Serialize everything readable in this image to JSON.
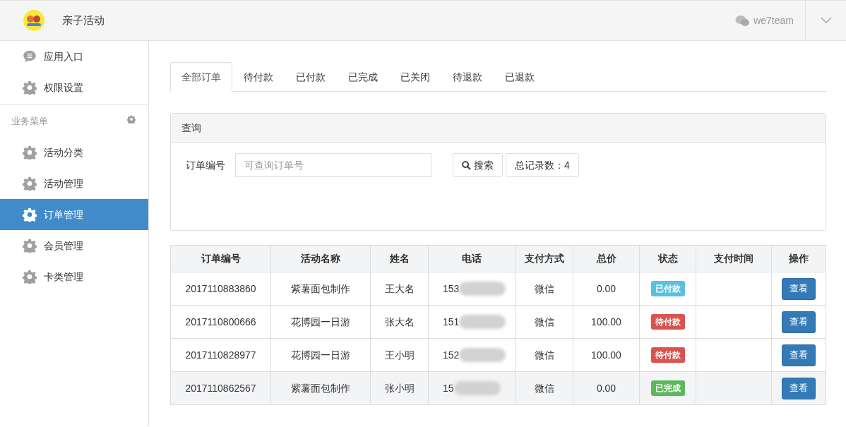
{
  "header": {
    "title": "亲子活动",
    "account": "we7team"
  },
  "sidebar": {
    "top_items": [
      {
        "label": "应用入口",
        "kind": "message",
        "selected": false
      },
      {
        "label": "权限设置",
        "kind": "settings",
        "selected": false
      }
    ],
    "section": {
      "title": "业务菜单",
      "items": [
        {
          "label": "活动分类",
          "kind": "settings",
          "selected": false
        },
        {
          "label": "活动管理",
          "kind": "settings",
          "selected": false
        },
        {
          "label": "订单管理",
          "kind": "settings",
          "selected": true
        },
        {
          "label": "会员管理",
          "kind": "settings",
          "selected": false
        },
        {
          "label": "卡类管理",
          "kind": "settings",
          "selected": false
        }
      ]
    }
  },
  "tabs": [
    {
      "label": "全部订单",
      "selected": true
    },
    {
      "label": "待付款",
      "selected": false
    },
    {
      "label": "已付款",
      "selected": false
    },
    {
      "label": "已完成",
      "selected": false
    },
    {
      "label": "已关闭",
      "selected": false
    },
    {
      "label": "待退款",
      "selected": false
    },
    {
      "label": "已退款",
      "selected": false
    }
  ],
  "query": {
    "title": "查询",
    "field_label": "订单编号",
    "placeholder": "可查询订单号",
    "search_button": "搜索",
    "total": "总记录数：4"
  },
  "table": {
    "columns": [
      "订单编号",
      "活动名称",
      "姓名",
      "电话",
      "支付方式",
      "总价",
      "状态",
      "支付时间",
      "操作"
    ],
    "rows": [
      {
        "order_no": "2017110883860",
        "activity": "紫薯面包制作",
        "name": "王大名",
        "phone": "153",
        "payment": "微信",
        "total": "0.00",
        "status": {
          "label": "已付款",
          "color": "#5bc0de"
        },
        "action": "查看",
        "selected": false
      },
      {
        "order_no": "2017110800666",
        "activity": "花博园一日游",
        "name": "张大名",
        "phone": "151",
        "payment": "微信",
        "total": "100.00",
        "status": {
          "label": "待付款",
          "color": "#d9534f"
        },
        "action": "查看",
        "selected": false
      },
      {
        "order_no": "2017110828977",
        "activity": "花博园一日游",
        "name": "王小明",
        "phone": "152",
        "payment": "微信",
        "total": "100.00",
        "status": {
          "label": "待付款",
          "color": "#d9534f"
        },
        "action": "查看",
        "selected": false
      },
      {
        "order_no": "2017110862567",
        "activity": "紫薯面包制作",
        "name": "张小明",
        "phone": "15",
        "payment": "微信",
        "total": "0.00",
        "status": {
          "label": "已完成",
          "color": "#5cb85c"
        },
        "action": "查看",
        "selected": true
      }
    ]
  }
}
